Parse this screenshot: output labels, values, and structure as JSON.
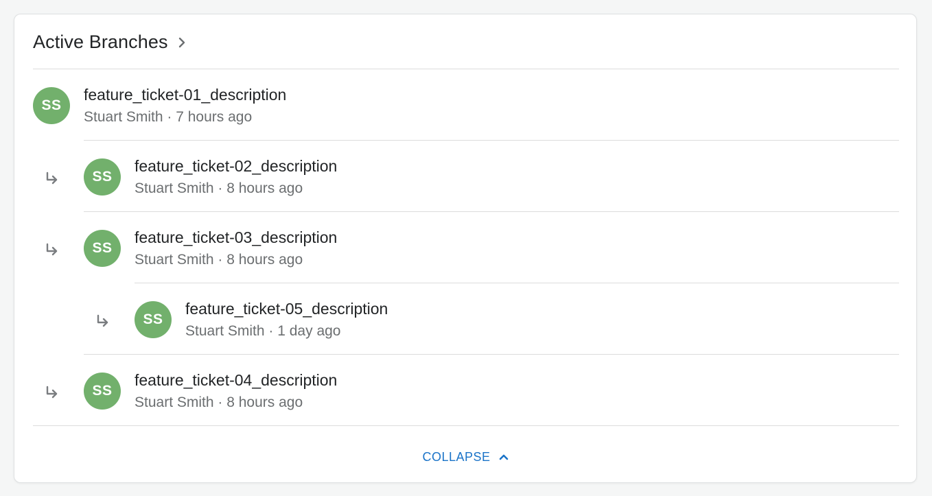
{
  "header": {
    "title": "Active Branches"
  },
  "branches": [
    {
      "initials": "SS",
      "name": "feature_ticket-01_description",
      "author": "Stuart Smith",
      "separator": "·",
      "time": "7 hours ago"
    },
    {
      "initials": "SS",
      "name": "feature_ticket-02_description",
      "author": "Stuart Smith",
      "separator": "·",
      "time": "8 hours ago"
    },
    {
      "initials": "SS",
      "name": "feature_ticket-03_description",
      "author": "Stuart Smith",
      "separator": "·",
      "time": "8 hours ago"
    },
    {
      "initials": "SS",
      "name": "feature_ticket-05_description",
      "author": "Stuart Smith",
      "separator": "·",
      "time": "1 day ago"
    },
    {
      "initials": "SS",
      "name": "feature_ticket-04_description",
      "author": "Stuart Smith",
      "separator": "·",
      "time": "8 hours ago"
    }
  ],
  "footer": {
    "collapse_label": "COLLAPSE"
  },
  "colors": {
    "avatar": "#72b06c",
    "link": "#1a73c8",
    "text_primary": "#222426",
    "text_secondary": "#6b6e70"
  },
  "icons": {
    "title": "chevron-right-icon",
    "child": "arrow-return-right-icon",
    "collapse": "chevron-up-icon"
  }
}
